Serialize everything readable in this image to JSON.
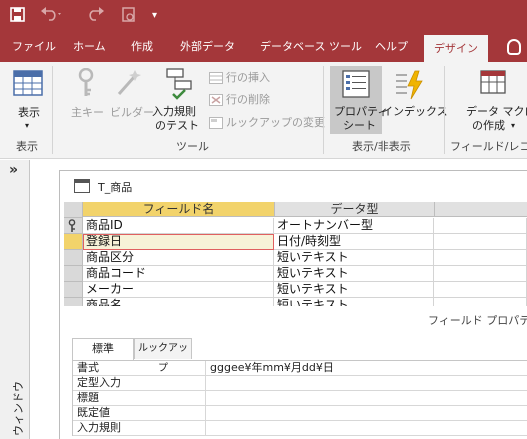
{
  "app": {
    "accent_color": "#a4373a",
    "ribbon_bg": "#f3f3f3",
    "highlight_color": "#f2d36b"
  },
  "qat": {
    "save_icon": "save-icon",
    "undo_icon": "undo-icon",
    "redo_icon": "redo-icon",
    "view_icon": "view-icon",
    "customize_glyph": "▾"
  },
  "tabs": [
    {
      "label": "ファイル"
    },
    {
      "label": "ホーム"
    },
    {
      "label": "作成"
    },
    {
      "label": "外部データ"
    },
    {
      "label": "データベース ツール"
    },
    {
      "label": "ヘルプ"
    },
    {
      "label": "デザイン"
    }
  ],
  "ribbon": {
    "view_button": "表示",
    "view_group": "表示",
    "primary_key": "主キー",
    "builder": "ビルダー",
    "test_rules_line1": "入力規則",
    "test_rules_line2": "のテスト",
    "insert_rows": "行の挿入",
    "delete_rows": "行の削除",
    "modify_lookups": "ルックアップの変更",
    "tools_group": "ツール",
    "property_sheet_line1": "プロパティ",
    "property_sheet_line2": "シート",
    "indexes": "インデックス",
    "show_hide_group": "表示/非表示",
    "create_macros_line1": "データ マクロ",
    "create_macros_line2": "の作成",
    "field_record_group": "フィールド/レコー"
  },
  "nav": {
    "chevron": "»",
    "vertical_label": "ウィンドウ"
  },
  "document": {
    "title": "T_商品"
  },
  "grid": {
    "headers": [
      "フィールド名",
      "データ型"
    ],
    "rows": [
      {
        "name": "商品ID",
        "type": "オートナンバー型",
        "key": true
      },
      {
        "name": "登録日",
        "type": "日付/時刻型",
        "key": false
      },
      {
        "name": "商品区分",
        "type": "短いテキスト",
        "key": false
      },
      {
        "name": "商品コード",
        "type": "短いテキスト",
        "key": false
      },
      {
        "name": "メーカー",
        "type": "短いテキスト",
        "key": false
      },
      {
        "name": "商品名",
        "type": "短いテキスト",
        "key": false
      }
    ]
  },
  "field_properties": {
    "label": "フィールド プロパティ",
    "tab_general": "標準",
    "tab_lookup": "ルックアップ",
    "rows": [
      {
        "name": "書式",
        "value": "gggee¥年mm¥月dd¥日"
      },
      {
        "name": "定型入力",
        "value": ""
      },
      {
        "name": "標題",
        "value": ""
      },
      {
        "name": "既定値",
        "value": ""
      },
      {
        "name": "入力規則",
        "value": ""
      }
    ]
  }
}
